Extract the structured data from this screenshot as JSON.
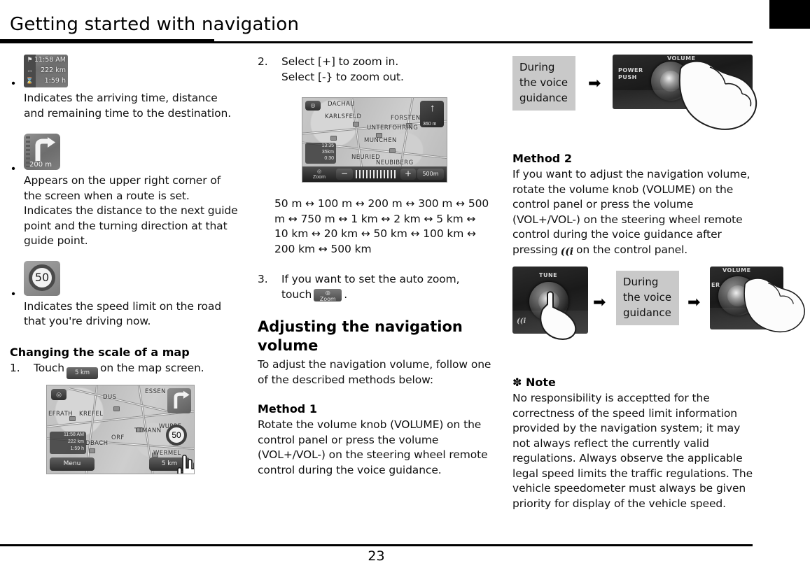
{
  "header": {
    "title": "Getting started with navigation"
  },
  "footer": {
    "page_number": "23"
  },
  "left_column": {
    "bullets": [
      {
        "icon_name": "eta-info-icon",
        "icon": {
          "arrival_time": "11:58 AM",
          "distance": "222 km",
          "remaining_time": "1:59 h"
        },
        "text": "Indicates the arriving time, distance and remaining time to the destination."
      },
      {
        "icon_name": "turn-direction-icon",
        "icon": {
          "distance": "200 m"
        },
        "text": "Appears on the upper right corner of the screen when a route is set. Indicates the distance to the next guide point and the turning direction at that guide point."
      },
      {
        "icon_name": "speed-limit-icon",
        "icon": {
          "speed": "50"
        },
        "text": "Indicates the speed limit on the road that you're driving now."
      }
    ],
    "section": {
      "heading": "Changing the scale of a map",
      "step_number": "1.",
      "step_text_before": "Touch",
      "inline_button_label": "5 km",
      "step_text_after": "on the map screen."
    },
    "map_screenshot": {
      "name": "map-screen-scale",
      "menu_button": "Menu",
      "scale_button": "5 km",
      "speed_limit": "50",
      "eta": {
        "arrival_time": "11:58 AM",
        "distance": "222 km",
        "remaining_time": "1:59 h"
      },
      "place_labels": [
        "EFRATH",
        "KREFEL",
        "ESSEN",
        "DUS",
        "TTMANN",
        "WUPPE",
        "WERMEL",
        "DBACH",
        "ORF"
      ]
    }
  },
  "mid_column": {
    "step2": {
      "number": "2.",
      "line1": "Select [+] to zoom in.",
      "line2": "Select [-} to zoom out."
    },
    "map_screenshot": {
      "name": "map-screen-zoom",
      "zoom_out_label": "−",
      "zoom_in_label": "+",
      "scale_label": "500m",
      "auto_zoom_label": "Zoom",
      "turn_distance": "360 m",
      "eta": {
        "arrival_time": "13:35",
        "distance": "35km",
        "remaining_time": "0:30"
      },
      "place_labels": [
        "DACHAU",
        "KARLSFELD",
        "UNTERFOHRING",
        "MUNCHEN",
        "NEURIED",
        "NEUBIBERG",
        "FORSTENR"
      ]
    },
    "scale_sequence": "50 m ↔ 100 m ↔ 200 m ↔ 300 m ↔ 500 m ↔ 750 m ↔ 1 km ↔ 2 km ↔ 5 km ↔ 10 km ↔ 20 km ↔ 50 km ↔ 100 km ↔ 200 km ↔ 500 km",
    "step3": {
      "number": "3.",
      "line1": "If you want to set the auto zoom,",
      "text_before": "touch",
      "inline_button_label": "Zoom",
      "text_after": "."
    },
    "volume_section": {
      "heading": "Adjusting the navigation volume",
      "intro": "To adjust the navigation volume, follow one of the described methods below:",
      "method1_heading": "Method 1",
      "method1_text": "Rotate the volume knob (VOLUME) on the control panel or press the volume (VOL+/VOL-) on the steering wheel remote control during the voice guidance."
    }
  },
  "right_column": {
    "figure1": {
      "callout": "During the voice guidance",
      "arrow": "➡",
      "panel_labels": [
        "VOLUME",
        "POWER",
        "PUSH"
      ]
    },
    "method2": {
      "heading": "Method 2",
      "text_before_icon": "If you want to adjust the navigation volume, rotate the volume knob (VOLUME) on the control panel or press the volume (VOL+/VOL-) on the steering wheel remote control during the voice guidance after pressing",
      "icon_name": "voice-info-icon",
      "text_after_icon": "on the control panel."
    },
    "figure2": {
      "panel1_label": "TUNE",
      "panel1_icon": "voice-info-icon",
      "arrow": "➡",
      "callout": "During the voice guidance",
      "panel2_labels": [
        "VOLUME",
        "ER"
      ]
    },
    "note": {
      "marker": "✽",
      "heading": "Note",
      "text": "No responsibility is acceptted for the correctness of the speed limit information provided by the navigation system; it may not always reflect the currently valid regulations. Always observe the applicable legal speed limits the traffic regulations. The vehicle speedometer must always be given priority for display of the vehicle speed."
    }
  }
}
